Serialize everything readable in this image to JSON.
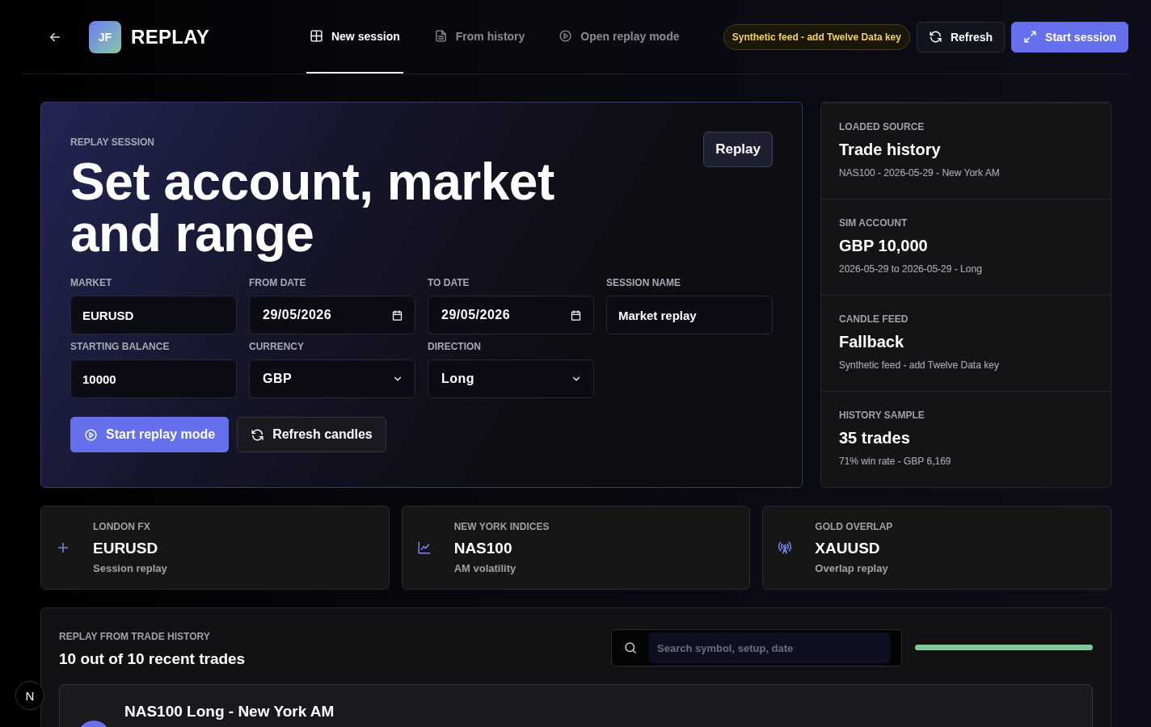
{
  "brand": {
    "initials": "JF",
    "title": "REPLAY"
  },
  "tabs": [
    {
      "label": "New session",
      "kind": "grid",
      "selected": true
    },
    {
      "label": "From history",
      "kind": "document",
      "selected": false
    },
    {
      "label": "Open replay mode",
      "kind": "play",
      "selected": false
    }
  ],
  "feed_badge": "Synthetic feed - add Twelve Data key",
  "header_buttons": [
    {
      "label": "Refresh",
      "kind": "secondary"
    },
    {
      "label": "Start session",
      "kind": "primary"
    }
  ],
  "session": {
    "eyebrow": "REPLAY SESSION",
    "title": "Set account, market and range",
    "badge": "Replay",
    "fields": [
      {
        "label": "MARKET",
        "value": "EURUSD",
        "kind": "text"
      },
      {
        "label": "FROM DATE",
        "value": "29/05/2026",
        "kind": "date"
      },
      {
        "label": "TO DATE",
        "value": "29/05/2026",
        "kind": "date"
      },
      {
        "label": "SESSION NAME",
        "value": "Market replay",
        "kind": "text"
      },
      {
        "label": "STARTING BALANCE",
        "value": "10000",
        "kind": "text"
      },
      {
        "label": "CURRENCY",
        "value": "GBP",
        "kind": "select"
      },
      {
        "label": "DIRECTION",
        "value": "Long",
        "kind": "select"
      }
    ],
    "actions": [
      {
        "label": "Start replay mode",
        "kind": "primary"
      },
      {
        "label": "Refresh candles",
        "kind": "secondary"
      }
    ]
  },
  "summary": [
    {
      "label": "LOADED SOURCE",
      "value": "Trade history",
      "detail": "NAS100 - 2026-05-29 - New York AM"
    },
    {
      "label": "SIM ACCOUNT",
      "value": "GBP 10,000",
      "detail": "2026-05-29 to 2026-05-29 - Long"
    },
    {
      "label": "CANDLE FEED",
      "value": "Fallback",
      "detail": "Synthetic feed - add Twelve Data key"
    },
    {
      "label": "HISTORY SAMPLE",
      "value": "35 trades",
      "detail": "71% win rate - GBP 6,169"
    }
  ],
  "markets": [
    {
      "label": "LONDON FX",
      "symbol": "EURUSD",
      "detail": "Session replay",
      "kind": "plus"
    },
    {
      "label": "NEW YORK INDICES",
      "symbol": "NAS100",
      "detail": "AM volatility",
      "kind": "chart"
    },
    {
      "label": "GOLD OVERLAP",
      "symbol": "XAUUSD",
      "detail": "Overlap replay",
      "kind": "broadcast"
    }
  ],
  "history": {
    "eyebrow": "REPLAY FROM TRADE HISTORY",
    "title": "10 out of 10 recent trades",
    "search": {
      "placeholder": "Search symbol, setup, date"
    },
    "progress": {
      "level": 1
    },
    "trades": [
      {
        "title": "NAS100 Long - New York AM"
      }
    ]
  },
  "dev_badge": "N"
}
